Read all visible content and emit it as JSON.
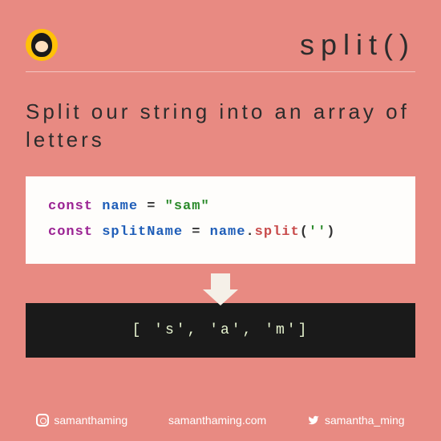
{
  "header": {
    "title": "split()"
  },
  "subtitle": "Split our string into an array of letters",
  "code": {
    "line1": {
      "kw": "const",
      "var": "name",
      "op": "=",
      "str": "\"sam\""
    },
    "line2": {
      "kw": "const",
      "var": "splitName",
      "op": "=",
      "obj": "name",
      "dot": ".",
      "method": "split",
      "open": "(",
      "arg": "''",
      "close": ")"
    }
  },
  "output": "[ 's', 'a', 'm']",
  "footer": {
    "instagram": "samanthaming",
    "website": "samanthaming.com",
    "twitter": "samantha_ming"
  }
}
